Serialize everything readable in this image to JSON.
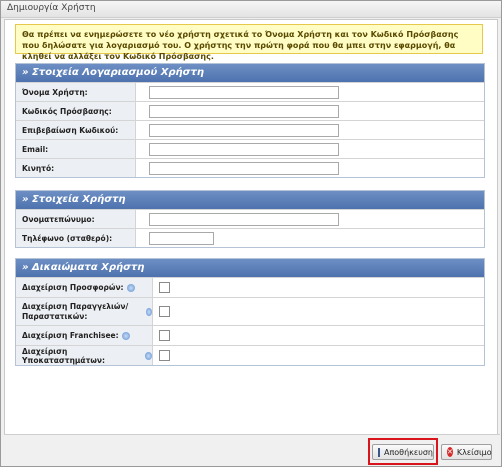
{
  "window": {
    "title": "Δημιουργία Χρήστη"
  },
  "notice": {
    "text": "Θα πρέπει να ενημερώσετε το νέο χρήστη σχετικά το Όνομα Χρήστη και τον Κωδικό Πρόσβασης που δηλώσατε για λογαριασμό του. Ο χρήστης την πρώτη φορά που θα μπει στην εφαρμογή, θα κληθεί να αλλάξει τον Κωδικό Πρόσβασης."
  },
  "account": {
    "header": "» Στοιχεία Λογαριασμού Χρήστη",
    "fields": [
      {
        "label": "Όνομα Χρήστη:",
        "value": ""
      },
      {
        "label": "Κωδικός Πρόσβασης:",
        "value": ""
      },
      {
        "label": "Επιβεβαίωση Κωδικού:",
        "value": ""
      },
      {
        "label": "Email:",
        "value": ""
      },
      {
        "label": "Κινητό:",
        "value": ""
      }
    ]
  },
  "user": {
    "header": "» Στοιχεία Χρήστη",
    "fields": [
      {
        "label": "Ονοματεπώνυμο:",
        "value": ""
      },
      {
        "label": "Τηλέφωνο (σταθερό):",
        "value": ""
      }
    ]
  },
  "rights": {
    "header": "» Δικαιώματα Χρήστη",
    "items": [
      {
        "label": "Διαχείριση Προσφορών:",
        "checked": false
      },
      {
        "label": "Διαχείριση Παραγγελιών/ Παραστατικών:",
        "checked": false
      },
      {
        "label": "Διαχείριση Franchisee:",
        "checked": false
      },
      {
        "label": "Διαχείριση Υποκαταστημάτων:",
        "checked": false
      }
    ]
  },
  "buttons": {
    "save": "Αποθήκευση",
    "close": "Κλείσιμο"
  },
  "icons": {
    "save": "save-icon",
    "close": "close-icon",
    "help": "help-icon"
  }
}
